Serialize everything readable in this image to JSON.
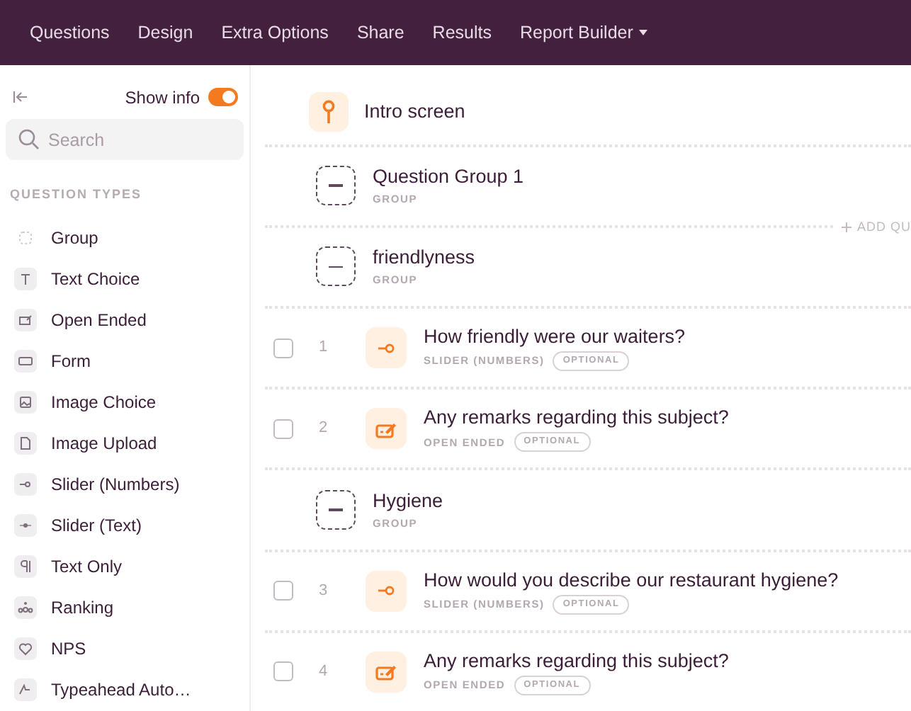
{
  "nav": [
    {
      "label": "Questions",
      "selected": false
    },
    {
      "label": "Design",
      "selected": false
    },
    {
      "label": "Extra Options",
      "selected": false
    },
    {
      "label": "Share",
      "selected": false
    },
    {
      "label": "Results",
      "selected": false
    },
    {
      "label": "Report Builder",
      "dropdown": true,
      "selected": false
    }
  ],
  "sidebar": {
    "show_info": {
      "label": "Show info",
      "on": true
    },
    "search": {
      "placeholder": "Search"
    },
    "section_title": "QUESTION TYPES",
    "items": [
      "Group",
      "Text Choice",
      "Open Ended",
      "Form",
      "Image Choice",
      "Image Upload",
      "Slider (Numbers)",
      "Slider (Text)",
      "Text Only",
      "Ranking",
      "NPS",
      "Typeahead Auto…"
    ]
  },
  "entries": [
    {
      "kind": "intro",
      "title": "Intro screen"
    },
    {
      "kind": "group",
      "title": "Question Group 1",
      "type": "GROUP",
      "add_label": "ADD QU"
    },
    {
      "kind": "group",
      "title": "friendlyness",
      "type": "GROUP"
    },
    {
      "kind": "slider",
      "number": "1",
      "title": "How friendly were our waiters?",
      "type": "SLIDER (NUMBERS)",
      "badge": "OPTIONAL",
      "checked": false
    },
    {
      "kind": "open_ended",
      "number": "2",
      "title": "Any remarks regarding this subject?",
      "type": "OPEN ENDED",
      "badge": "OPTIONAL",
      "checked": false
    },
    {
      "kind": "group",
      "title": "Hygiene",
      "type": "GROUP"
    },
    {
      "kind": "slider",
      "number": "3",
      "title": "How would you describe our restaurant hygiene?",
      "type": "SLIDER (NUMBERS)",
      "badge": "OPTIONAL",
      "checked": false
    },
    {
      "kind": "open_ended",
      "number": "4",
      "title": "Any remarks regarding this subject?",
      "type": "OPEN ENDED",
      "badge": "OPTIONAL",
      "checked": false
    }
  ]
}
